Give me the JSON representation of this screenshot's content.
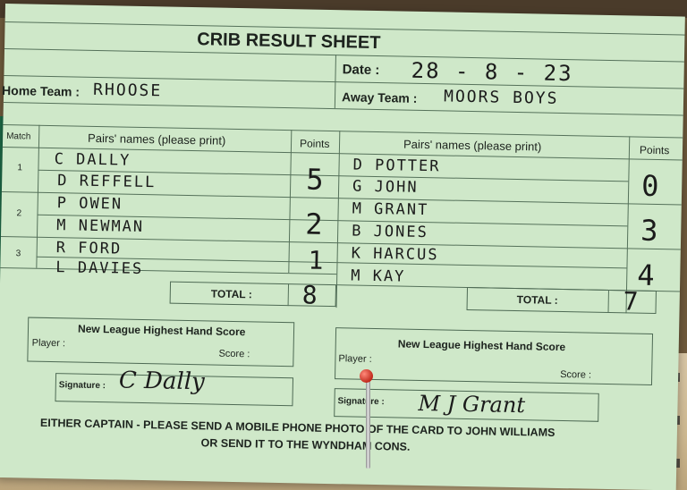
{
  "card": {
    "title": "CRIB RESULT SHEET",
    "date_label": "Date :",
    "date_value": "28 - 8 - 23",
    "home_team_label": "Home Team :",
    "home_team_value": "RHOOSE",
    "away_team_label": "Away Team :",
    "away_team_value": "MOORS BOYS"
  },
  "table": {
    "match_header": "Match",
    "pairs_header": "Pairs' names (please print)",
    "points_header": "Points",
    "matches": [
      {
        "number": "1",
        "home": [
          "C DALLY",
          "D REFFELL"
        ],
        "home_points": "5",
        "away": [
          "D POTTER",
          "G JOHN"
        ],
        "away_points": "0"
      },
      {
        "number": "2",
        "home": [
          "P OWEN",
          "M NEWMAN"
        ],
        "home_points": "2",
        "away": [
          "M GRANT",
          "B JONES"
        ],
        "away_points": "3"
      },
      {
        "number": "3",
        "home": [
          "R FORD",
          "L DAVIES"
        ],
        "home_points": "1",
        "away": [
          "K HARCUS",
          "M KAY"
        ],
        "away_points": "4"
      }
    ],
    "total_label": "TOTAL :",
    "home_total": "8",
    "away_total": "7"
  },
  "hand_score": {
    "title": "New League Highest Hand Score",
    "player_label": "Player :",
    "score_label": "Score :"
  },
  "signature_label": "Signature :",
  "signatures": {
    "home": "C Dally",
    "away": "M J Grant"
  },
  "footer": {
    "line1": "EITHER CAPTAIN - PLEASE SEND A MOBILE PHONE PHOTO OF THE CARD TO JOHN WILLIAMS",
    "line2": "OR SEND IT TO THE WYNDHAM CONS."
  },
  "colors": {
    "card": "#cfe8c9",
    "rule": "#55715a",
    "felt": "#1d6a47",
    "pin_head": "#c0291c"
  }
}
